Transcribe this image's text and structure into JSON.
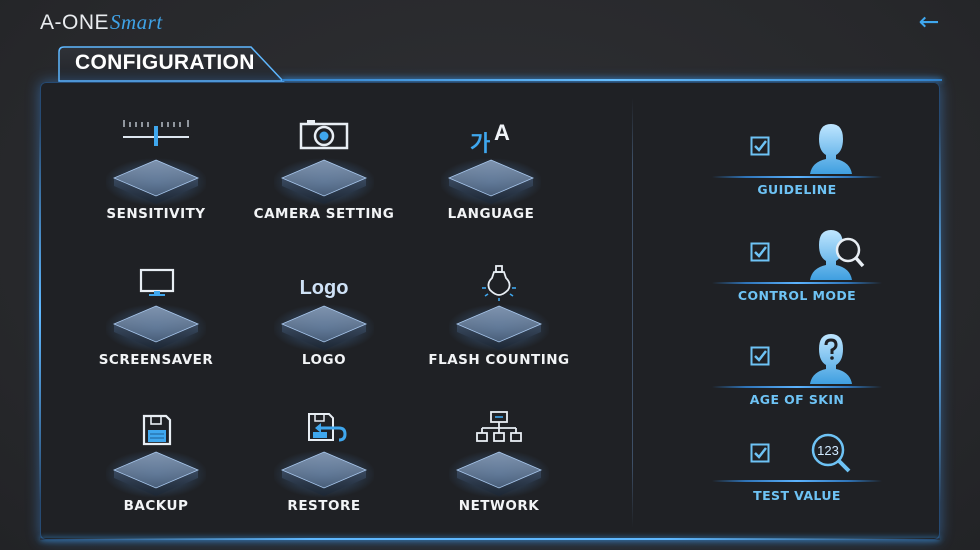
{
  "header": {
    "brand_main": "A-ONE",
    "brand_script": "Smart",
    "back_glyph": "←",
    "title": "CONFIGURATION"
  },
  "tiles": [
    {
      "label": "SENSITIVITY",
      "icon": "ruler-slider-icon"
    },
    {
      "label": "CAMERA SETTING",
      "icon": "camera-icon"
    },
    {
      "label": "LANGUAGE",
      "icon": "language-icon",
      "glyph_a": "가",
      "glyph_b": "A"
    },
    {
      "label": "SCREENSAVER",
      "icon": "monitor-icon"
    },
    {
      "label": "LOGO",
      "icon": "logo-text-icon",
      "text": "Logo"
    },
    {
      "label": "FLASH COUNTING",
      "icon": "lightbulb-icon"
    },
    {
      "label": "BACKUP",
      "icon": "floppy-disk-icon"
    },
    {
      "label": "RESTORE",
      "icon": "restore-disk-icon"
    },
    {
      "label": "NETWORK",
      "icon": "network-tree-icon"
    }
  ],
  "options": [
    {
      "label": "GUIDELINE",
      "checked": true,
      "icon": "person-silhouette-icon"
    },
    {
      "label": "CONTROL MODE",
      "checked": true,
      "icon": "person-magnifier-icon"
    },
    {
      "label": "AGE OF SKIN",
      "checked": true,
      "icon": "person-question-icon"
    },
    {
      "label": "TEST VALUE",
      "checked": true,
      "icon": "numbers-magnifier-icon",
      "text": "123"
    }
  ],
  "colors": {
    "accent": "#3fa2e6",
    "label_blue": "#6ec3f5",
    "panel": "#1f2125",
    "background": "#2a2b2f"
  }
}
